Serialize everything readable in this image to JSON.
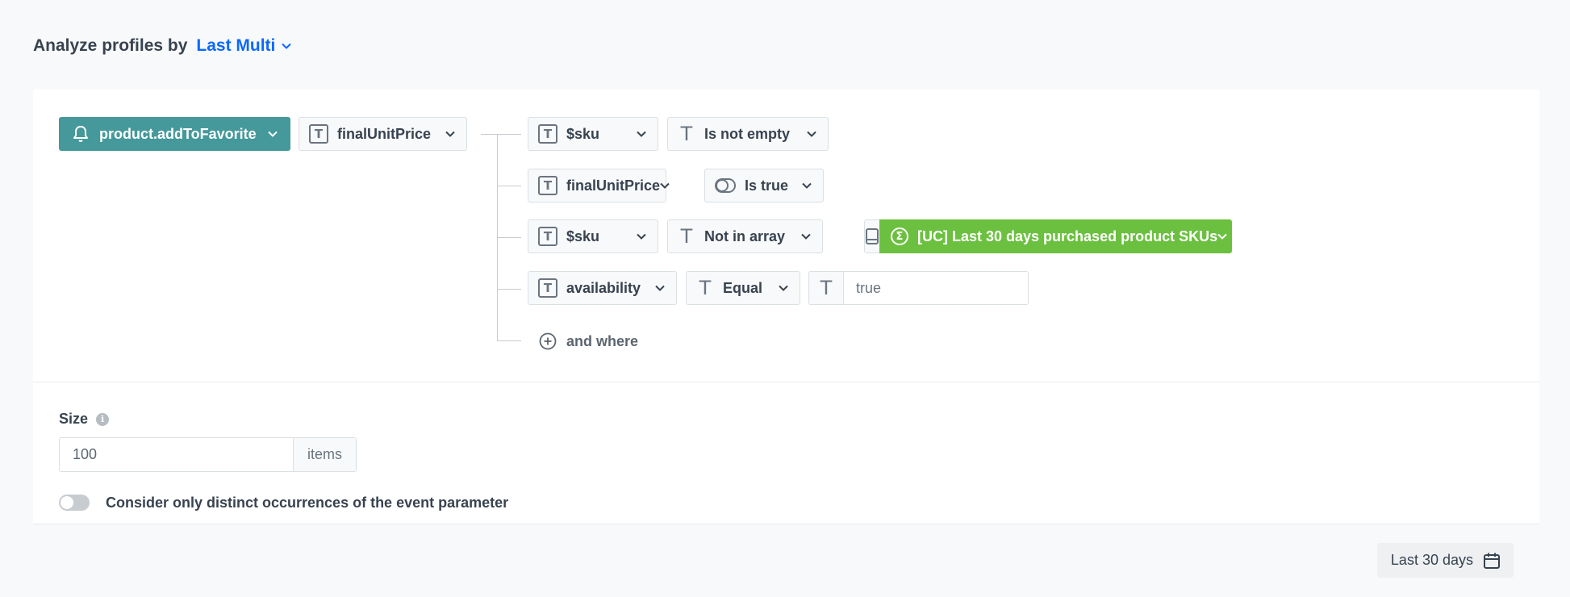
{
  "header": {
    "title": "Analyze profiles by",
    "analyze_by": "Last Multi"
  },
  "event": {
    "name": "product.addToFavorite",
    "parameter": "finalUnitPrice"
  },
  "filters": [
    {
      "attribute": "$sku",
      "operator": "Is not empty"
    },
    {
      "attribute": "finalUnitPrice",
      "operator": "Is true"
    },
    {
      "attribute": "$sku",
      "operator": "Not in array",
      "aggregate": "[UC] Last 30 days purchased product SKUs"
    },
    {
      "attribute": "availability",
      "operator": "Equal",
      "value": "true"
    }
  ],
  "and_where_label": "and where",
  "size": {
    "label": "Size",
    "value": "100",
    "suffix": "items"
  },
  "distinct_toggle": {
    "label": "Consider only distinct occurrences of the event parameter",
    "enabled": false
  },
  "footer": {
    "date_range": "Last 30 days"
  },
  "colors": {
    "event_pill": "#45999b",
    "aggregate_pill": "#6cc040",
    "link": "#0b68ff"
  }
}
